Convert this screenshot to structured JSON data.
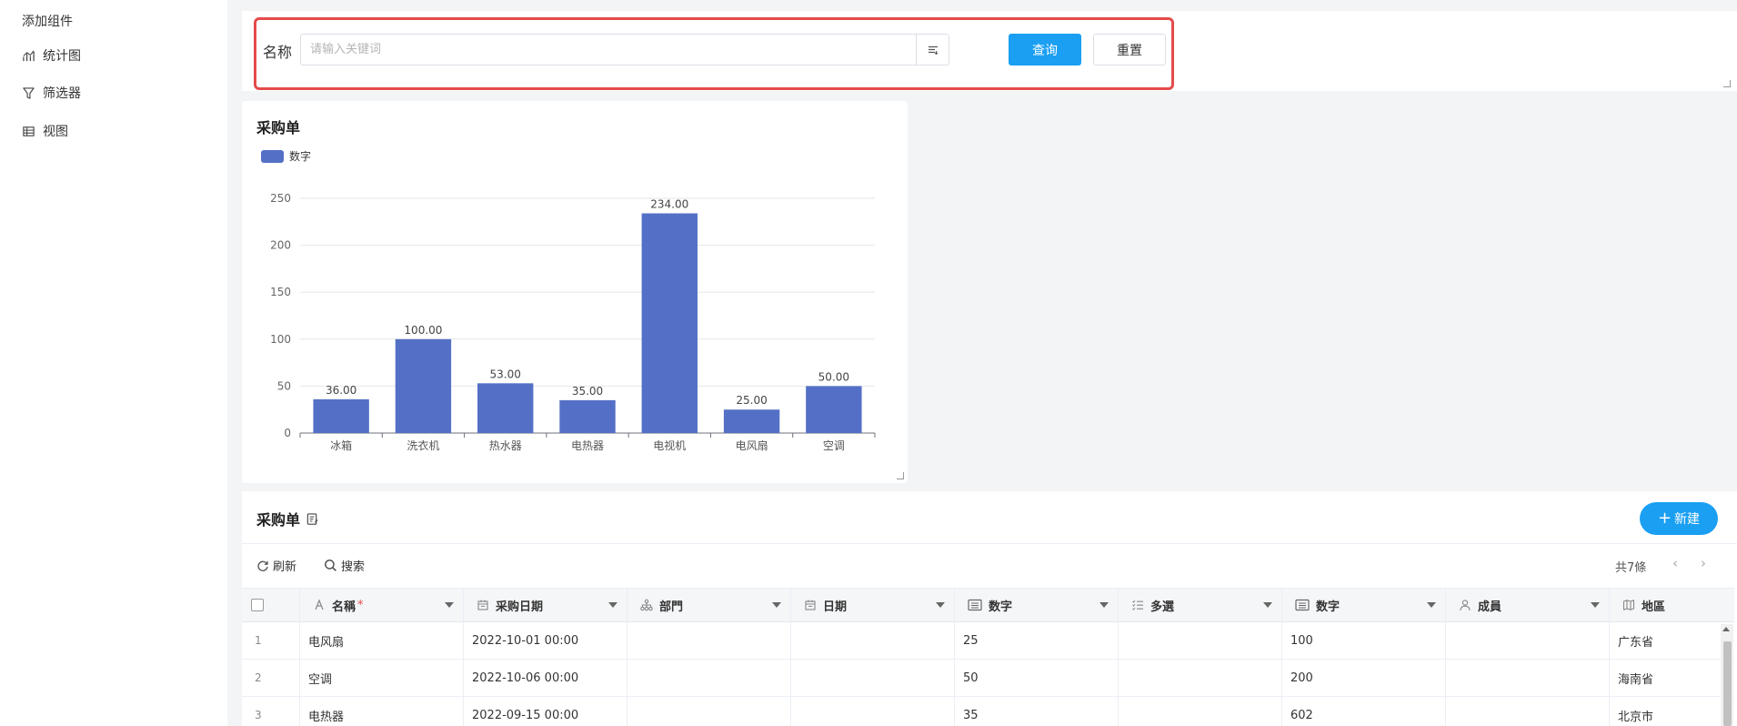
{
  "sidebar": {
    "title": "添加组件",
    "items": [
      {
        "label": "统计图"
      },
      {
        "label": "筛选器"
      },
      {
        "label": "视图"
      }
    ]
  },
  "filter": {
    "label": "名称",
    "placeholder": "请输入关键词",
    "query_label": "查询",
    "reset_label": "重置"
  },
  "chart_panel": {
    "title": "采购单",
    "legend_label": "数字"
  },
  "chart_data": {
    "type": "bar",
    "categories": [
      "冰箱",
      "洗衣机",
      "热水器",
      "电热器",
      "电视机",
      "电风扇",
      "空调"
    ],
    "series": [
      {
        "name": "数字",
        "values": [
          36,
          100,
          53,
          35,
          234,
          25,
          50
        ]
      }
    ],
    "data_labels": [
      "36.00",
      "100.00",
      "53.00",
      "35.00",
      "234.00",
      "25.00",
      "50.00"
    ],
    "yticks": [
      0,
      50,
      100,
      150,
      200,
      250
    ],
    "ylim": [
      0,
      250
    ],
    "grid": true,
    "legend": "top-left",
    "color": "#5470c6"
  },
  "table_panel": {
    "title": "采购单",
    "new_label": "新建",
    "refresh_label": "刷新",
    "search_label": "搜索",
    "total_label": "共7條",
    "prev": "‹",
    "next": "›",
    "columns": [
      {
        "label": "名稱",
        "icon": "text-icon",
        "required": "*"
      },
      {
        "label": "采购日期",
        "icon": "calendar-icon"
      },
      {
        "label": "部門",
        "icon": "org-icon"
      },
      {
        "label": "日期",
        "icon": "calendar-icon"
      },
      {
        "label": "数字",
        "icon": "number-icon"
      },
      {
        "label": "多選",
        "icon": "multiselect-icon"
      },
      {
        "label": "数字",
        "icon": "number-icon"
      },
      {
        "label": "成員",
        "icon": "user-icon"
      },
      {
        "label": "地區",
        "icon": "map-icon"
      }
    ],
    "rows": [
      {
        "num": "1",
        "name": "电风扇",
        "purchase_date": "2022-10-01 00:00",
        "dept": "",
        "date": "",
        "number1": "25",
        "multi": "",
        "number2": "100",
        "member": "",
        "region": "广东省"
      },
      {
        "num": "2",
        "name": "空调",
        "purchase_date": "2022-10-06 00:00",
        "dept": "",
        "date": "",
        "number1": "50",
        "multi": "",
        "number2": "200",
        "member": "",
        "region": "海南省"
      },
      {
        "num": "3",
        "name": "电热器",
        "purchase_date": "2022-09-15 00:00",
        "dept": "",
        "date": "",
        "number1": "35",
        "multi": "",
        "number2": "602",
        "member": "",
        "region": "北京市"
      }
    ]
  },
  "colors": {
    "accent": "#1a9ff2",
    "highlight_border": "#e44b4b",
    "bar": "#5470c6"
  }
}
